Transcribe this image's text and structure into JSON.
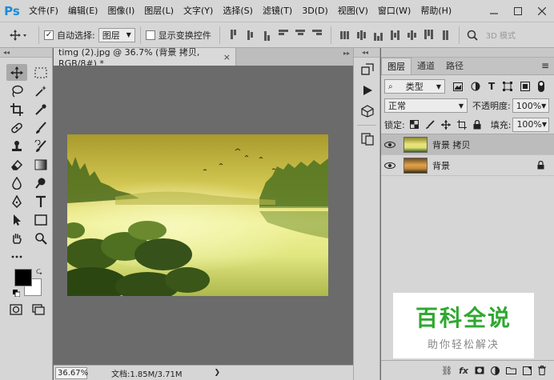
{
  "menu": {
    "logo": "Ps",
    "items": [
      "文件(F)",
      "编辑(E)",
      "图像(I)",
      "图层(L)",
      "文字(Y)",
      "选择(S)",
      "滤镜(T)",
      "3D(D)",
      "视图(V)",
      "窗口(W)",
      "帮助(H)"
    ]
  },
  "options": {
    "auto_select_label": "自动选择:",
    "auto_select_value": "图层",
    "transform_label": "显示变换控件",
    "mode3d": "3D 模式"
  },
  "document": {
    "tab_title": "timg (2).jpg @ 36.7% (背景 拷贝, RGB/8#) *",
    "zoom": "36.67%",
    "doc_info": "文档:1.85M/3.71M"
  },
  "layers_panel": {
    "tabs": [
      "图层",
      "通道",
      "路径"
    ],
    "filter_label": "类型",
    "blend_mode": "正常",
    "opacity_label": "不透明度:",
    "opacity_value": "100%",
    "lock_label": "锁定:",
    "fill_label": "填充:",
    "fill_value": "100%",
    "layers": [
      {
        "name": "背景 拷贝",
        "selected": true
      },
      {
        "name": "背景",
        "selected": false,
        "locked": true
      }
    ]
  },
  "watermark": {
    "title": "百科全说",
    "subtitle": "助你轻松解决"
  },
  "colors": {
    "foreground": "#000000",
    "background": "#ffffff"
  }
}
